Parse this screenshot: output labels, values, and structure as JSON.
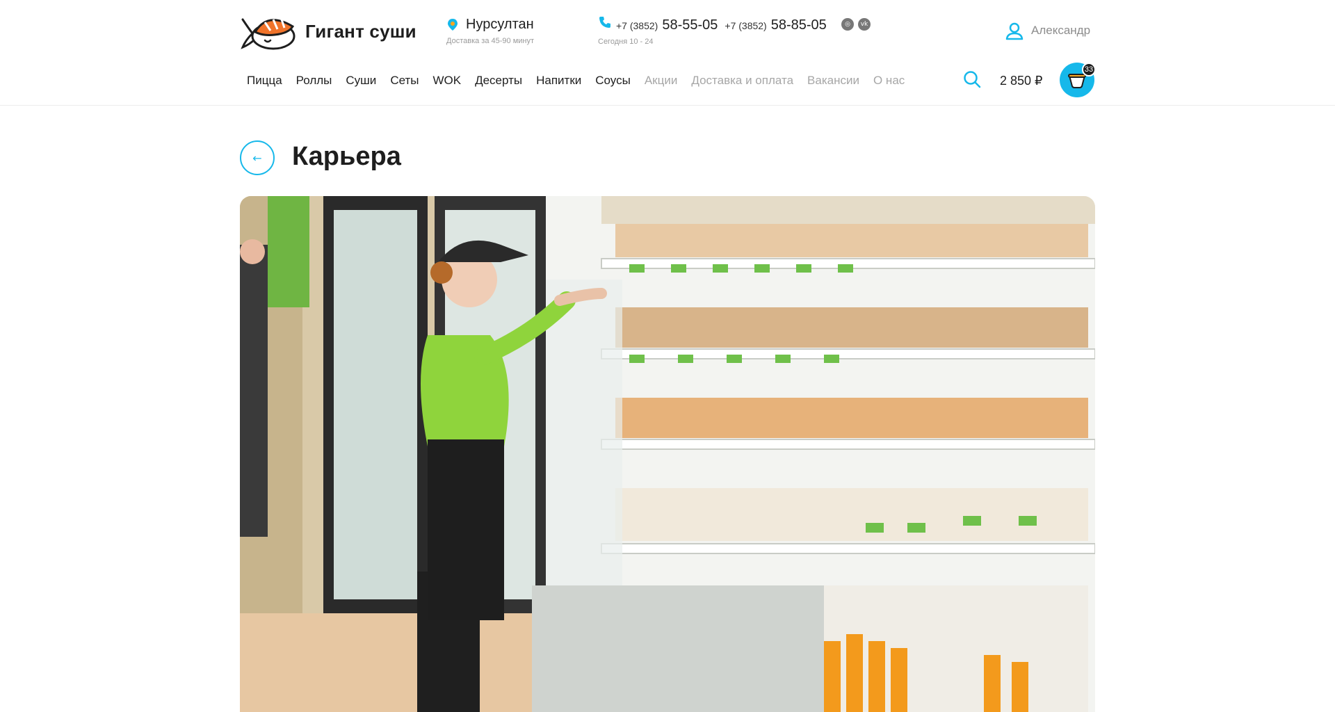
{
  "brand": {
    "name": "Гигант суши"
  },
  "location": {
    "city": "Нурсултан",
    "delivery_time": "Доставка за 45-90 минут"
  },
  "contacts": {
    "phones": [
      {
        "code": "+7 (3852)",
        "number": "58-55-05"
      },
      {
        "code": "+7 (3852)",
        "number": "58-85-05"
      }
    ],
    "hours": "Сегодня 10 - 24",
    "socials": [
      "instagram-icon",
      "vk-icon"
    ]
  },
  "user": {
    "name": "Александр"
  },
  "nav": {
    "items": [
      {
        "label": "Пицца"
      },
      {
        "label": "Роллы"
      },
      {
        "label": "Суши"
      },
      {
        "label": "Сеты"
      },
      {
        "label": "WOK"
      },
      {
        "label": "Десерты"
      },
      {
        "label": "Напитки"
      },
      {
        "label": "Соусы"
      },
      {
        "label": "Акции"
      },
      {
        "label": "Доставка и оплата"
      },
      {
        "label": "Вакансии"
      },
      {
        "label": "О нас"
      }
    ]
  },
  "cart": {
    "total": "2 850 ₽",
    "count": "33"
  },
  "page": {
    "title": "Карьера"
  },
  "colors": {
    "accent": "#16b8ea",
    "text": "#1e1e1e",
    "muted": "#a6a6a6"
  }
}
